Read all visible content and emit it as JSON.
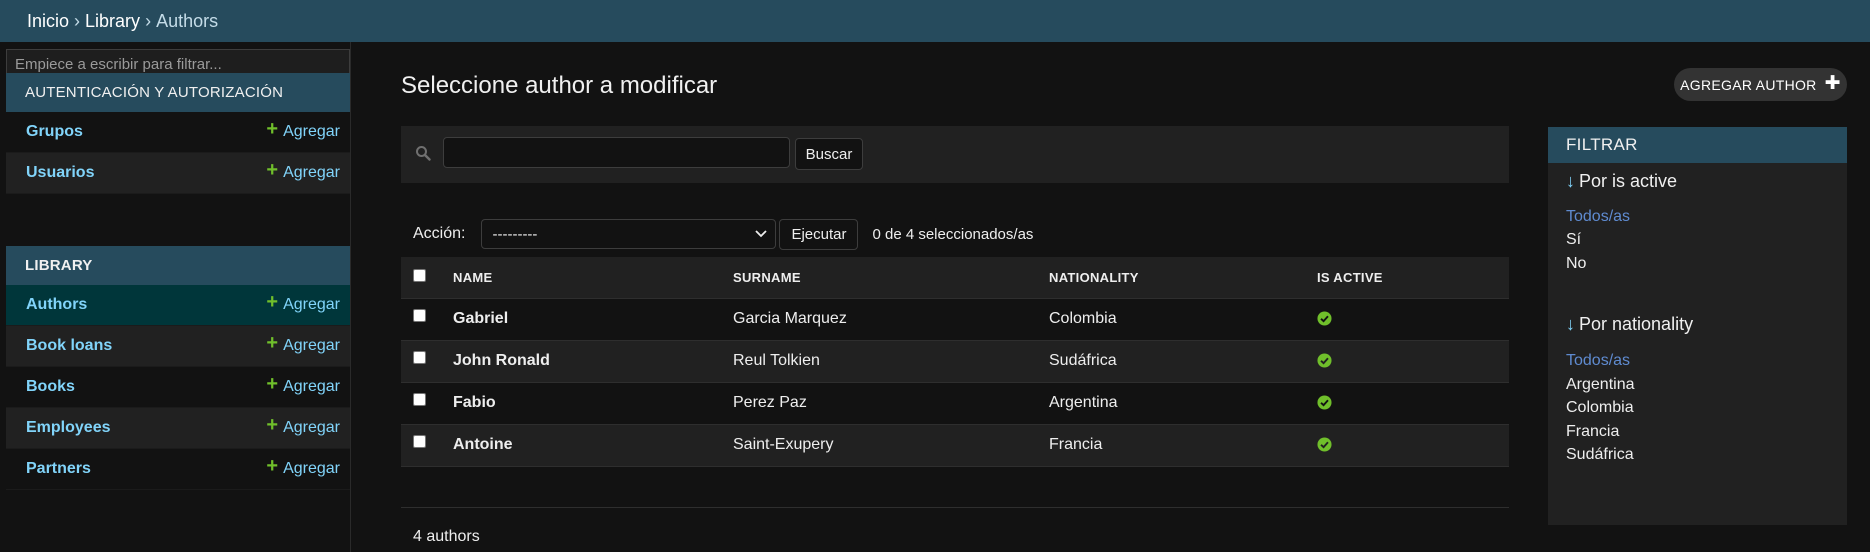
{
  "breadcrumbs": {
    "home": "Inicio",
    "app": "Library",
    "current": "Authors",
    "separator": "›"
  },
  "sidebar": {
    "filter_placeholder": "Empiece a escribir para filtrar...",
    "modules": [
      {
        "caption": "AUTENTICACIÓN Y AUTORIZACIÓN",
        "models": [
          {
            "name": "Grupos",
            "add_label": "Agregar"
          },
          {
            "name": "Usuarios",
            "add_label": "Agregar"
          }
        ]
      },
      {
        "caption": "LIBRARY",
        "models": [
          {
            "name": "Authors",
            "add_label": "Agregar"
          },
          {
            "name": "Book loans",
            "add_label": "Agregar"
          },
          {
            "name": "Books",
            "add_label": "Agregar"
          },
          {
            "name": "Employees",
            "add_label": "Agregar"
          },
          {
            "name": "Partners",
            "add_label": "Agregar"
          }
        ]
      }
    ]
  },
  "main": {
    "title": "Seleccione author a modificar",
    "add_button_label": "AGREGAR AUTHOR",
    "search": {
      "value": "",
      "button_label": "Buscar"
    },
    "actions": {
      "label": "Acción:",
      "selected_option": "---------",
      "execute_label": "Ejecutar",
      "counter": "0 de 4 seleccionados/as"
    },
    "table": {
      "columns": [
        "NAME",
        "SURNAME",
        "NATIONALITY",
        "IS ACTIVE"
      ],
      "rows": [
        {
          "name": "Gabriel",
          "surname": "Garcia Marquez",
          "nationality": "Colombia",
          "is_active": true
        },
        {
          "name": "John Ronald",
          "surname": "Reul Tolkien",
          "nationality": "Sudáfrica",
          "is_active": true
        },
        {
          "name": "Fabio",
          "surname": "Perez Paz",
          "nationality": "Argentina",
          "is_active": true
        },
        {
          "name": "Antoine",
          "surname": "Saint-Exupery",
          "nationality": "Francia",
          "is_active": true
        }
      ]
    },
    "result_count": "4 authors"
  },
  "filter": {
    "title": "FILTRAR",
    "groups": [
      {
        "heading": "Por is active",
        "options": [
          "Todos/as",
          "Sí",
          "No"
        ],
        "selected": "Todos/as"
      },
      {
        "heading": "Por nationality",
        "options": [
          "Todos/as",
          "Argentina",
          "Colombia",
          "Francia",
          "Sudáfrica"
        ],
        "selected": "Todos/as"
      }
    ]
  },
  "colors": {
    "header_bg": "#264b5d",
    "link": "#81d4fa",
    "add_plus": "#70bf2b",
    "active_yes": "#70bf2b",
    "current_row": "#00363a",
    "selected_filter": "#5f8bd0"
  },
  "icons": {
    "search": "search-icon",
    "add": "plus-icon",
    "boolean_true": "check-circle-icon",
    "select_caret": "chevron-down-icon",
    "sort_arrow": "arrow-down-icon"
  }
}
